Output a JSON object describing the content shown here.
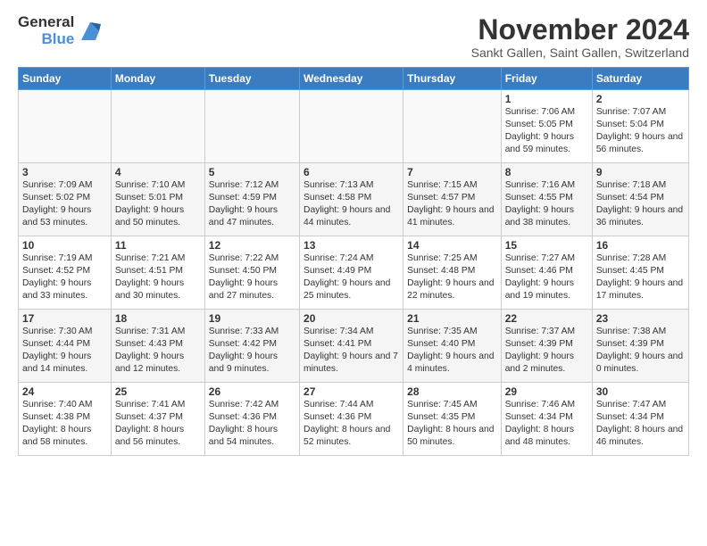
{
  "logo": {
    "general": "General",
    "blue": "Blue"
  },
  "header": {
    "month": "November 2024",
    "location": "Sankt Gallen, Saint Gallen, Switzerland"
  },
  "weekdays": [
    "Sunday",
    "Monday",
    "Tuesday",
    "Wednesday",
    "Thursday",
    "Friday",
    "Saturday"
  ],
  "weeks": [
    [
      {
        "day": "",
        "info": ""
      },
      {
        "day": "",
        "info": ""
      },
      {
        "day": "",
        "info": ""
      },
      {
        "day": "",
        "info": ""
      },
      {
        "day": "",
        "info": ""
      },
      {
        "day": "1",
        "info": "Sunrise: 7:06 AM\nSunset: 5:05 PM\nDaylight: 9 hours and 59 minutes."
      },
      {
        "day": "2",
        "info": "Sunrise: 7:07 AM\nSunset: 5:04 PM\nDaylight: 9 hours and 56 minutes."
      }
    ],
    [
      {
        "day": "3",
        "info": "Sunrise: 7:09 AM\nSunset: 5:02 PM\nDaylight: 9 hours and 53 minutes."
      },
      {
        "day": "4",
        "info": "Sunrise: 7:10 AM\nSunset: 5:01 PM\nDaylight: 9 hours and 50 minutes."
      },
      {
        "day": "5",
        "info": "Sunrise: 7:12 AM\nSunset: 4:59 PM\nDaylight: 9 hours and 47 minutes."
      },
      {
        "day": "6",
        "info": "Sunrise: 7:13 AM\nSunset: 4:58 PM\nDaylight: 9 hours and 44 minutes."
      },
      {
        "day": "7",
        "info": "Sunrise: 7:15 AM\nSunset: 4:57 PM\nDaylight: 9 hours and 41 minutes."
      },
      {
        "day": "8",
        "info": "Sunrise: 7:16 AM\nSunset: 4:55 PM\nDaylight: 9 hours and 38 minutes."
      },
      {
        "day": "9",
        "info": "Sunrise: 7:18 AM\nSunset: 4:54 PM\nDaylight: 9 hours and 36 minutes."
      }
    ],
    [
      {
        "day": "10",
        "info": "Sunrise: 7:19 AM\nSunset: 4:52 PM\nDaylight: 9 hours and 33 minutes."
      },
      {
        "day": "11",
        "info": "Sunrise: 7:21 AM\nSunset: 4:51 PM\nDaylight: 9 hours and 30 minutes."
      },
      {
        "day": "12",
        "info": "Sunrise: 7:22 AM\nSunset: 4:50 PM\nDaylight: 9 hours and 27 minutes."
      },
      {
        "day": "13",
        "info": "Sunrise: 7:24 AM\nSunset: 4:49 PM\nDaylight: 9 hours and 25 minutes."
      },
      {
        "day": "14",
        "info": "Sunrise: 7:25 AM\nSunset: 4:48 PM\nDaylight: 9 hours and 22 minutes."
      },
      {
        "day": "15",
        "info": "Sunrise: 7:27 AM\nSunset: 4:46 PM\nDaylight: 9 hours and 19 minutes."
      },
      {
        "day": "16",
        "info": "Sunrise: 7:28 AM\nSunset: 4:45 PM\nDaylight: 9 hours and 17 minutes."
      }
    ],
    [
      {
        "day": "17",
        "info": "Sunrise: 7:30 AM\nSunset: 4:44 PM\nDaylight: 9 hours and 14 minutes."
      },
      {
        "day": "18",
        "info": "Sunrise: 7:31 AM\nSunset: 4:43 PM\nDaylight: 9 hours and 12 minutes."
      },
      {
        "day": "19",
        "info": "Sunrise: 7:33 AM\nSunset: 4:42 PM\nDaylight: 9 hours and 9 minutes."
      },
      {
        "day": "20",
        "info": "Sunrise: 7:34 AM\nSunset: 4:41 PM\nDaylight: 9 hours and 7 minutes."
      },
      {
        "day": "21",
        "info": "Sunrise: 7:35 AM\nSunset: 4:40 PM\nDaylight: 9 hours and 4 minutes."
      },
      {
        "day": "22",
        "info": "Sunrise: 7:37 AM\nSunset: 4:39 PM\nDaylight: 9 hours and 2 minutes."
      },
      {
        "day": "23",
        "info": "Sunrise: 7:38 AM\nSunset: 4:39 PM\nDaylight: 9 hours and 0 minutes."
      }
    ],
    [
      {
        "day": "24",
        "info": "Sunrise: 7:40 AM\nSunset: 4:38 PM\nDaylight: 8 hours and 58 minutes."
      },
      {
        "day": "25",
        "info": "Sunrise: 7:41 AM\nSunset: 4:37 PM\nDaylight: 8 hours and 56 minutes."
      },
      {
        "day": "26",
        "info": "Sunrise: 7:42 AM\nSunset: 4:36 PM\nDaylight: 8 hours and 54 minutes."
      },
      {
        "day": "27",
        "info": "Sunrise: 7:44 AM\nSunset: 4:36 PM\nDaylight: 8 hours and 52 minutes."
      },
      {
        "day": "28",
        "info": "Sunrise: 7:45 AM\nSunset: 4:35 PM\nDaylight: 8 hours and 50 minutes."
      },
      {
        "day": "29",
        "info": "Sunrise: 7:46 AM\nSunset: 4:34 PM\nDaylight: 8 hours and 48 minutes."
      },
      {
        "day": "30",
        "info": "Sunrise: 7:47 AM\nSunset: 4:34 PM\nDaylight: 8 hours and 46 minutes."
      }
    ]
  ]
}
